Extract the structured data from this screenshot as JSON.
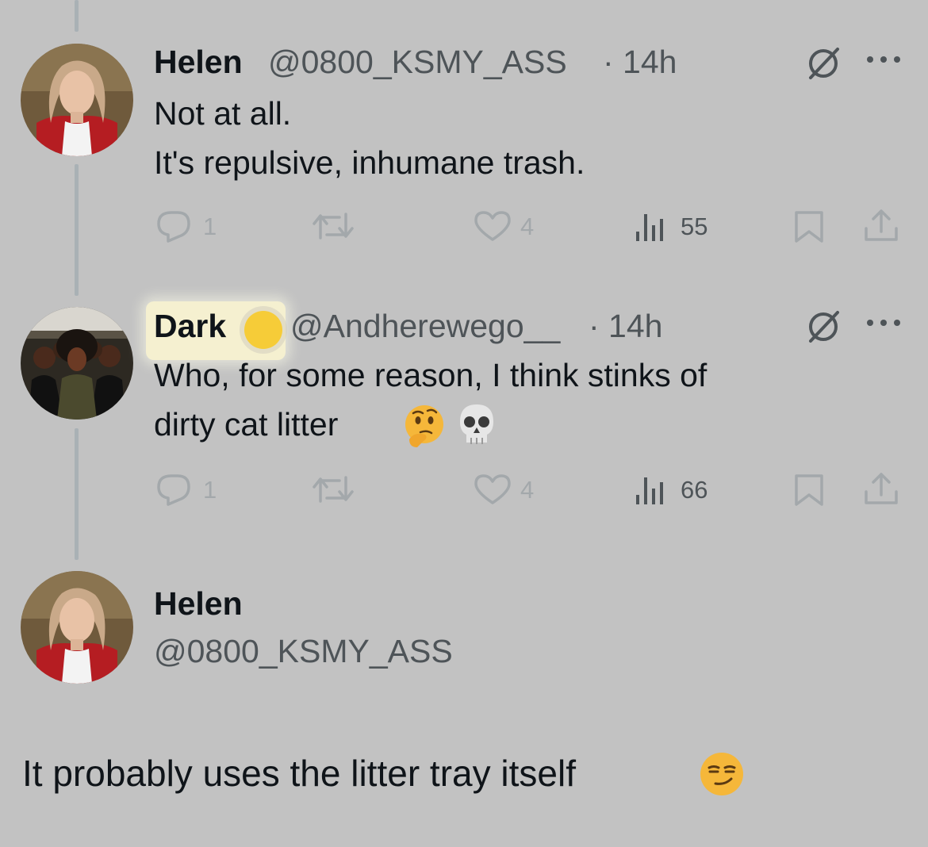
{
  "tweets": [
    {
      "name": "Helen",
      "handle": "@0800_KSMY_ASS",
      "time": "· 14h",
      "text_lines": [
        "Not at all.",
        "It's repulsive, inhumane trash."
      ],
      "replies": "1",
      "likes": "4",
      "views": "55"
    },
    {
      "name": "Dark",
      "handle": "@Andherewego__",
      "time": "· 14h",
      "text_lines": [
        "Who, for some reason, I think stinks of",
        "dirty cat litter"
      ],
      "emojis": [
        "thinking-face",
        "skull"
      ],
      "replies": "1",
      "likes": "4",
      "views": "66"
    }
  ],
  "main_tweet": {
    "name": "Helen",
    "handle": "@0800_KSMY_ASS",
    "text": "It probably uses the litter tray itself",
    "emoji": "smirking-face"
  },
  "icons": [
    "grok-icon",
    "more-icon",
    "reply-icon",
    "retweet-icon",
    "like-icon",
    "views-icon",
    "bookmark-icon",
    "share-icon"
  ],
  "colors": {
    "background": "#c2c2c2",
    "text": "#0f1419",
    "secondary": "#4e5458",
    "muted": "#a3a8ab",
    "highlight": "#f5f0d0",
    "cursor_dot": "#f6cc38"
  }
}
